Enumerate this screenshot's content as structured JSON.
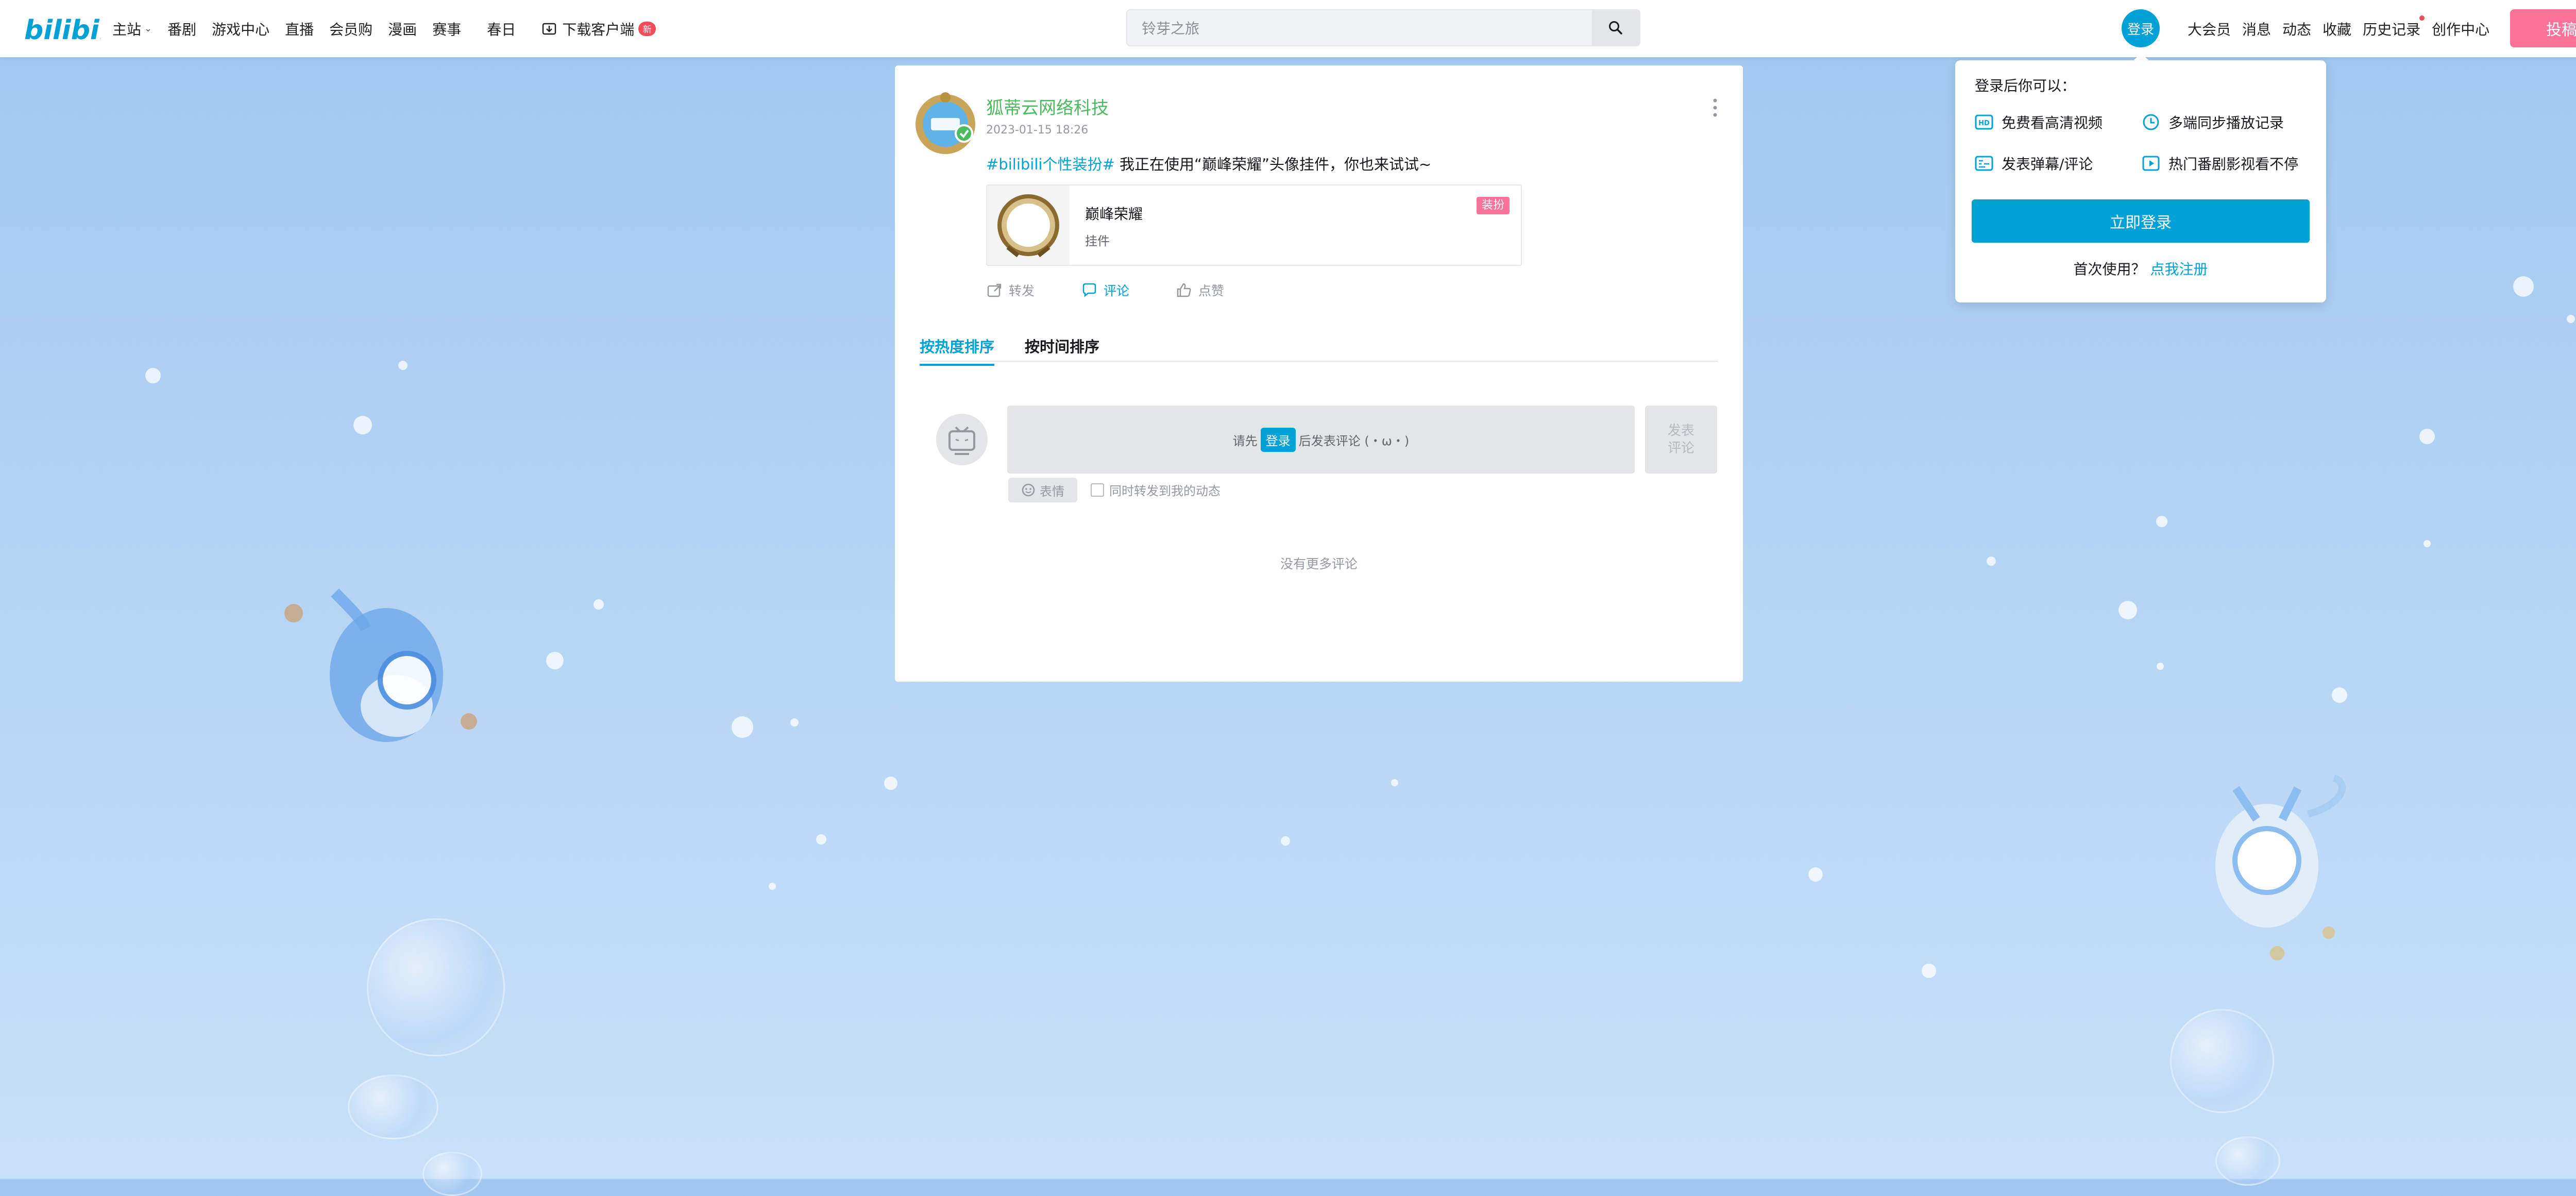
{
  "header": {
    "nav": [
      {
        "label": "主站",
        "has_dropdown": true
      },
      {
        "label": "番剧"
      },
      {
        "label": "游戏中心"
      },
      {
        "label": "直播"
      },
      {
        "label": "会员购"
      },
      {
        "label": "漫画"
      },
      {
        "label": "赛事"
      }
    ],
    "spring": "春日",
    "download": {
      "label": "下载客户端",
      "badge": "新"
    },
    "search": {
      "placeholder": "铃芽之旅"
    },
    "login_label": "登录",
    "right_nav": [
      "大会员",
      "消息",
      "动态",
      "收藏",
      "历史记录",
      "创作中心"
    ],
    "upload_label": "投稿",
    "colors": {
      "brand_blue": "#00a1d6",
      "pink": "#fb7299"
    }
  },
  "login_popup": {
    "title": "登录后你可以：",
    "features": [
      {
        "icon": "hd-icon",
        "label": "免费看高清视频"
      },
      {
        "icon": "clock-icon",
        "label": "多端同步播放记录"
      },
      {
        "icon": "danmaku-icon",
        "label": "发表弹幕/评论"
      },
      {
        "icon": "play-square-icon",
        "label": "热门番剧影视看不停"
      }
    ],
    "login_button": "立即登录",
    "register_prompt": "首次使用？",
    "register_link": "点我注册"
  },
  "post": {
    "author": "狐蒂云网络科技",
    "time": "2023-01-15 18:26",
    "topic": "#bilibili个性装扮#",
    "text": " 我正在使用“巅峰荣耀”头像挂件，你也来试试~",
    "decoration": {
      "name": "巅峰荣耀",
      "type": "挂件",
      "tag": "装扮"
    },
    "actions": [
      {
        "icon": "share-icon",
        "label": "转发"
      },
      {
        "icon": "comment-icon",
        "label": "评论"
      },
      {
        "icon": "like-icon",
        "label": "点赞"
      }
    ]
  },
  "comments": {
    "sort_tabs": [
      "按热度排序",
      "按时间排序"
    ],
    "input_prefix": "请先",
    "input_login": "登录",
    "input_suffix": "后发表评论 (・ω・)",
    "submit_label": "发表\n评论",
    "emoji_label": "表情",
    "forward_label": "同时转发到我的动态",
    "no_more": "没有更多评论"
  }
}
